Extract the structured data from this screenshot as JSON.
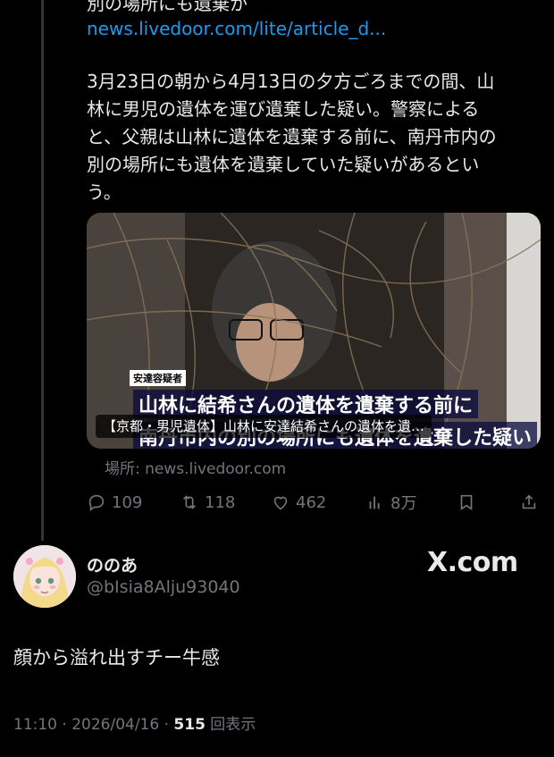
{
  "quoted": {
    "top_cut_text": "別の場所にも遺棄か",
    "link": "news.livedoor.com/lite/article_d...",
    "body": "3月23日の朝から4月13日の夕方ごろまでの間、山\n林に男児の遺体を運び遺棄した疑い。警察による\nと、父親は山林に遺体を遺棄する前に、南丹市内の\n別の場所にも遺体を遺棄していた疑いがあるとい\nう。",
    "card": {
      "title": "【京都・男児遺体】山林に安達結希さんの遺体を遺…",
      "burn_tag": "安達容疑者",
      "burn_line1": "山林に結希さんの遺体を遺棄する前に",
      "burn_line2": "南丹市内の別の場所にも遺体を遺棄した疑い"
    },
    "source": "場所: news.livedoor.com",
    "actions": {
      "replies": "109",
      "reposts": "118",
      "likes": "462",
      "views": "8万"
    }
  },
  "reply": {
    "name": "ののあ",
    "handle": "@bIsia8Alju93040",
    "watermark": "X.com",
    "text": "顔から溢れ出すチー牛感",
    "time": "11:10 · 2026/04/16 · ",
    "views_count": "515",
    "views_label": " 回表示"
  },
  "colors": {
    "background": "#000000",
    "text": "#e7e9ea",
    "muted": "#71767b",
    "link": "#1d9bf0"
  }
}
